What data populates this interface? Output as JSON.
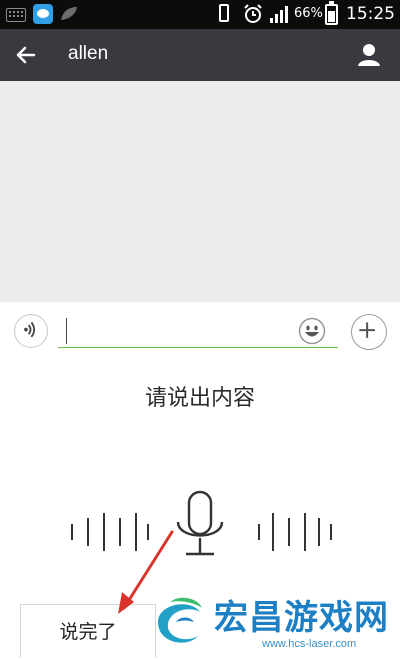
{
  "status_bar": {
    "battery_percent": "66%",
    "time": "15:25",
    "icons": [
      "keyboard-icon",
      "app-icon",
      "leaf-icon",
      "phone-vibrate-icon",
      "alarm-icon",
      "signal-icon",
      "battery-charging-icon"
    ]
  },
  "header": {
    "title": "allen",
    "back_icon": "back-arrow-icon",
    "profile_icon": "profile-icon",
    "background": "#393a3f"
  },
  "input_bar": {
    "value": "",
    "accent_color": "#62c046",
    "icons": [
      "voice-icon",
      "emoji-icon",
      "plus-icon"
    ]
  },
  "voice_panel": {
    "prompt": "请说出内容",
    "done_label": "说完了",
    "icons": [
      "microphone-icon",
      "sound-wave-icon"
    ]
  },
  "watermark": {
    "text": "宏昌游戏网",
    "url": "www.hcs-laser.com",
    "color": "#1d7fc4"
  }
}
